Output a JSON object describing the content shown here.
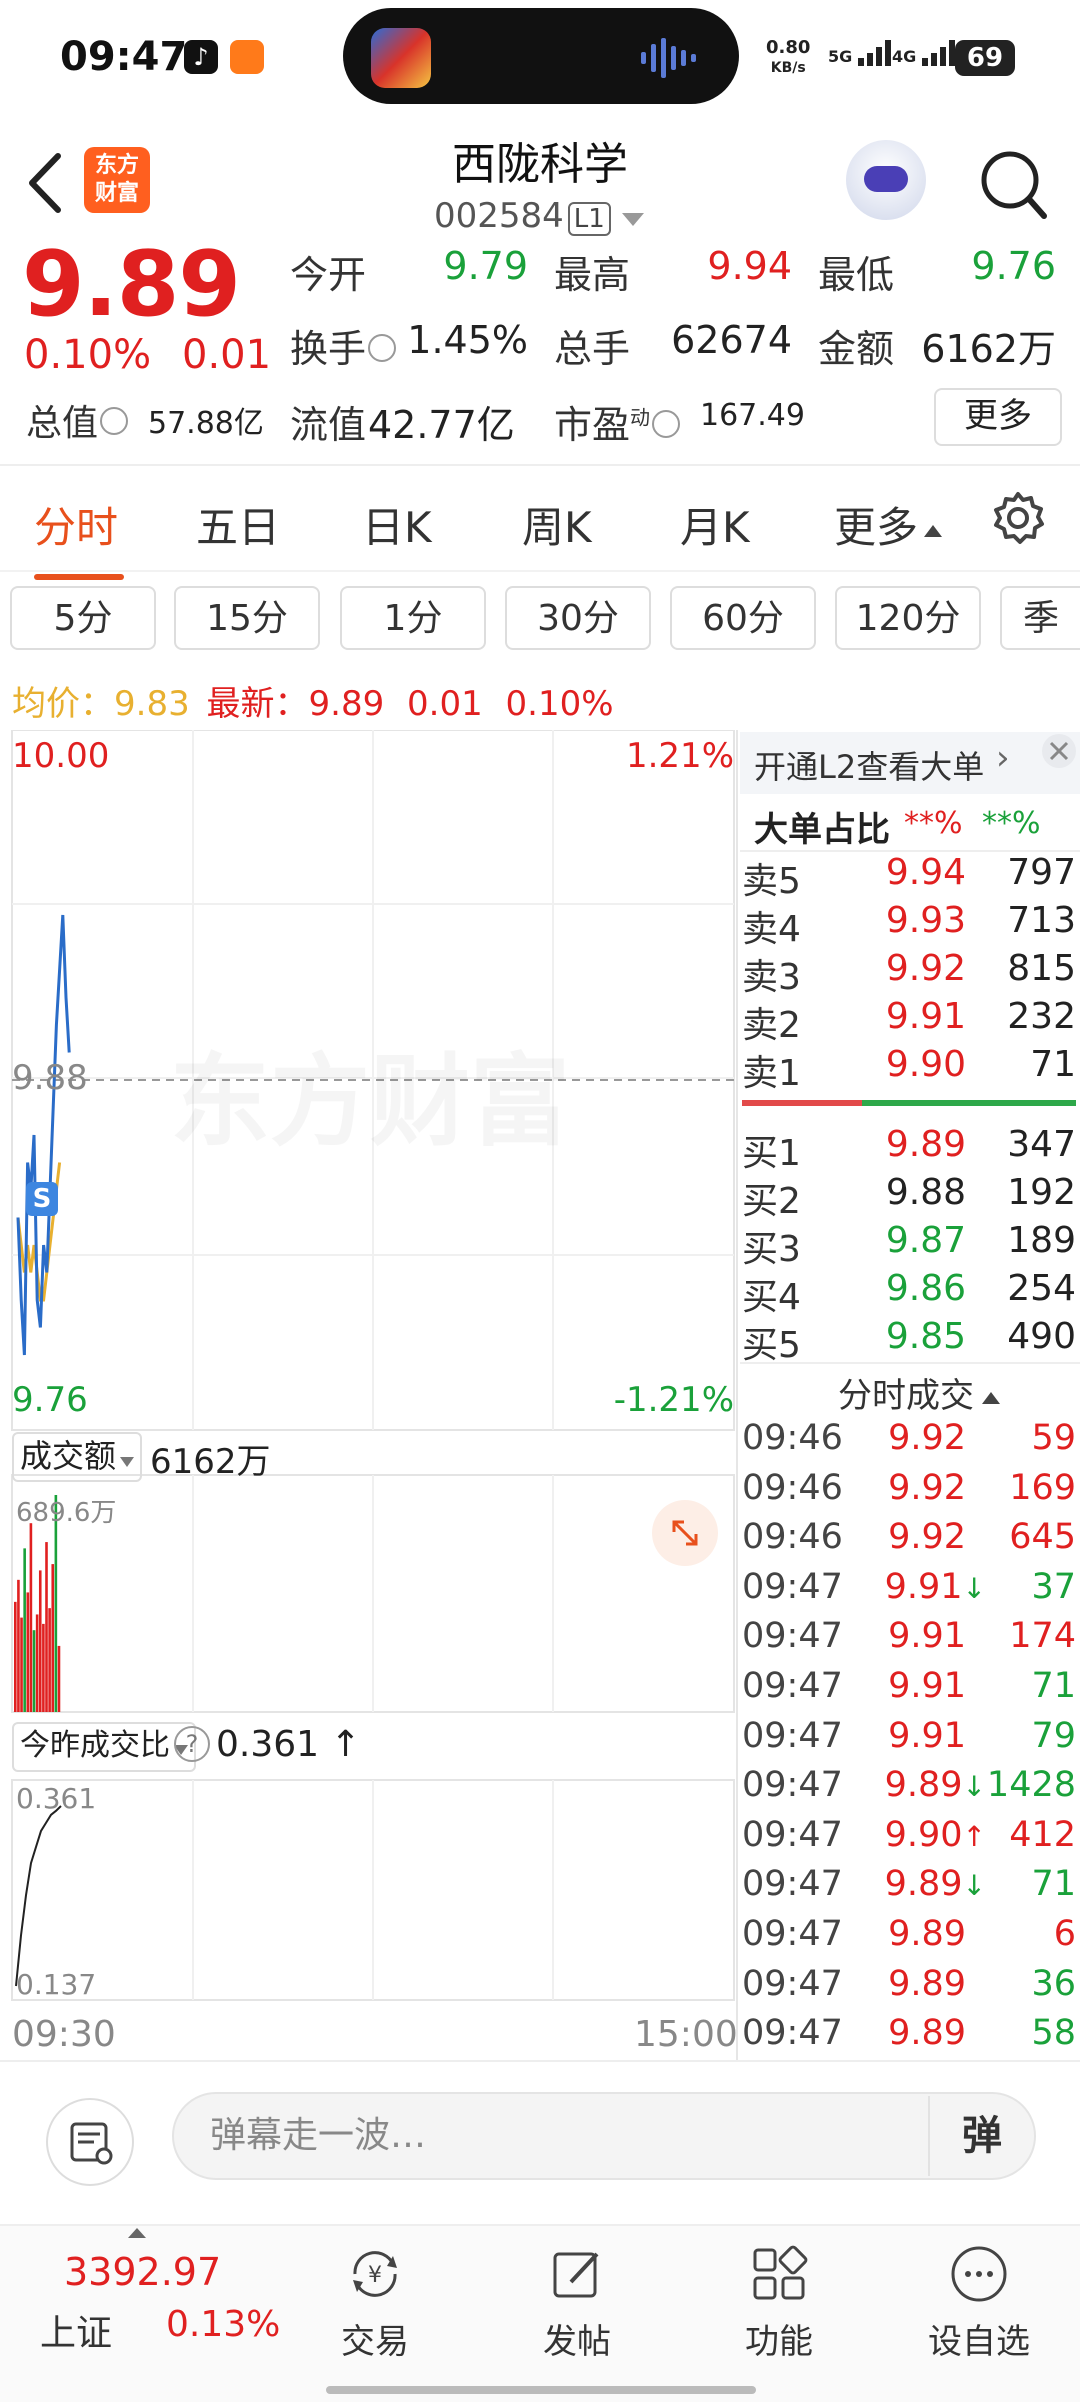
{
  "status_bar": {
    "time": "09:47",
    "net_speed_value": "0.80",
    "net_speed_unit": "KB/s",
    "signal_a": "5G",
    "signal_b": "4G",
    "battery": "69"
  },
  "header": {
    "app_logo_text": "东方\n财富",
    "stock_name": "西陇科学",
    "stock_code": "002584",
    "level_badge": "L1"
  },
  "quote": {
    "price": "9.89",
    "change_pct": "0.10%",
    "change": "0.01",
    "open_label": "今开",
    "open": "9.79",
    "high_label": "最高",
    "high": "9.94",
    "low_label": "最低",
    "low": "9.76",
    "turnover_label": "换手",
    "turnover": "1.45%",
    "volume_label": "总手",
    "volume": "62674",
    "amount_label": "金额",
    "amount": "6162万",
    "mktcap_label": "总值",
    "mktcap": "57.88亿",
    "float_label": "流值",
    "float": "42.77亿",
    "pe_label": "市盈",
    "pe_sup": "动",
    "pe": "167.49",
    "more_btn": "更多"
  },
  "tabs": [
    "分时",
    "五日",
    "日K",
    "周K",
    "月K",
    "更多"
  ],
  "periods": [
    "5分",
    "15分",
    "1分",
    "30分",
    "60分",
    "120分",
    "季"
  ],
  "avg_info": {
    "avg_label": "均价：",
    "avg": "9.83",
    "latest_label": "最新：",
    "latest": "9.89",
    "chg": "0.01",
    "pct": "0.10%"
  },
  "chart": {
    "y_top": "10.00",
    "y_mid": "9.88",
    "y_bot": "9.76",
    "pct_top": "1.21%",
    "pct_bot": "-1.21%",
    "watermark": "东方财富",
    "marker": "S",
    "vol_selector": "成交额",
    "vol_total": "6162万",
    "vol_max": "689.6万",
    "ratio_selector": "今昨成交比",
    "ratio_help": "?",
    "ratio_value": "0.361 ↑",
    "ratio_max": "0.361",
    "ratio_min": "0.137",
    "x_start": "09:30",
    "x_end": "15:00"
  },
  "chart_data": {
    "type": "line",
    "x_range": [
      "09:30",
      "15:00"
    ],
    "ylim": [
      9.76,
      10.0
    ],
    "ref_price": 9.88,
    "series": [
      {
        "values": [
          9.83,
          9.8,
          9.78,
          9.85,
          9.84,
          9.86,
          9.8,
          9.79,
          9.82,
          9.81,
          9.84,
          9.87,
          9.9,
          9.92,
          9.94,
          9.91,
          9.89
        ]
      },
      {
        "values": [
          9.83,
          9.82,
          9.81,
          9.82,
          9.81,
          9.82,
          9.81,
          9.8,
          9.8,
          9.81,
          9.82,
          9.83,
          9.84,
          9.85
        ]
      }
    ],
    "volume_bars": [
      {
        "v": 350,
        "c": "red"
      },
      {
        "v": 420,
        "c": "red"
      },
      {
        "v": 300,
        "c": "red"
      },
      {
        "v": 520,
        "c": "green"
      },
      {
        "v": 380,
        "c": "red"
      },
      {
        "v": 600,
        "c": "red"
      },
      {
        "v": 260,
        "c": "green"
      },
      {
        "v": 310,
        "c": "red"
      },
      {
        "v": 450,
        "c": "red"
      },
      {
        "v": 280,
        "c": "red"
      },
      {
        "v": 540,
        "c": "red"
      },
      {
        "v": 330,
        "c": "red"
      },
      {
        "v": 470,
        "c": "red"
      },
      {
        "v": 689.6,
        "c": "green"
      },
      {
        "v": 210,
        "c": "red"
      }
    ],
    "volume_max": 689.6,
    "ratio_values": [
      0.137,
      0.2,
      0.25,
      0.29,
      0.31,
      0.33,
      0.34,
      0.35,
      0.355,
      0.361
    ],
    "ratio_ylim": [
      0.137,
      0.361
    ]
  },
  "order_book": {
    "l2_banner": "开通L2查看大单",
    "big_order_label": "大单占比",
    "big_order_a": "**%",
    "big_order_b": "**%",
    "asks": [
      {
        "label": "卖5",
        "price": "9.94",
        "vol": "797",
        "color": "red"
      },
      {
        "label": "卖4",
        "price": "9.93",
        "vol": "713",
        "color": "red"
      },
      {
        "label": "卖3",
        "price": "9.92",
        "vol": "815",
        "color": "red"
      },
      {
        "label": "卖2",
        "price": "9.91",
        "vol": "232",
        "color": "red"
      },
      {
        "label": "卖1",
        "price": "9.90",
        "vol": "71",
        "color": "red"
      }
    ],
    "bids": [
      {
        "label": "买1",
        "price": "9.89",
        "vol": "347",
        "color": "red"
      },
      {
        "label": "买2",
        "price": "9.88",
        "vol": "192",
        "color": "black"
      },
      {
        "label": "买3",
        "price": "9.87",
        "vol": "189",
        "color": "green"
      },
      {
        "label": "买4",
        "price": "9.86",
        "vol": "254",
        "color": "green"
      },
      {
        "label": "买5",
        "price": "9.85",
        "vol": "490",
        "color": "green"
      }
    ]
  },
  "trades": {
    "title": "分时成交",
    "rows": [
      {
        "time": "09:46",
        "price": "9.92",
        "arrow": "",
        "vol": "59",
        "vcolor": "red"
      },
      {
        "time": "09:46",
        "price": "9.92",
        "arrow": "",
        "vol": "169",
        "vcolor": "red"
      },
      {
        "time": "09:46",
        "price": "9.92",
        "arrow": "",
        "vol": "645",
        "vcolor": "red"
      },
      {
        "time": "09:47",
        "price": "9.91",
        "arrow": "↓",
        "vol": "37",
        "vcolor": "green"
      },
      {
        "time": "09:47",
        "price": "9.91",
        "arrow": "",
        "vol": "174",
        "vcolor": "red"
      },
      {
        "time": "09:47",
        "price": "9.91",
        "arrow": "",
        "vol": "71",
        "vcolor": "green"
      },
      {
        "time": "09:47",
        "price": "9.91",
        "arrow": "",
        "vol": "79",
        "vcolor": "green"
      },
      {
        "time": "09:47",
        "price": "9.89",
        "arrow": "↓",
        "vol": "1428",
        "vcolor": "green"
      },
      {
        "time": "09:47",
        "price": "9.90",
        "arrow": "↑",
        "vol": "412",
        "vcolor": "red"
      },
      {
        "time": "09:47",
        "price": "9.89",
        "arrow": "↓",
        "vol": "71",
        "vcolor": "green"
      },
      {
        "time": "09:47",
        "price": "9.89",
        "arrow": "",
        "vol": "6",
        "vcolor": "red"
      },
      {
        "time": "09:47",
        "price": "9.89",
        "arrow": "",
        "vol": "36",
        "vcolor": "green"
      },
      {
        "time": "09:47",
        "price": "9.89",
        "arrow": "",
        "vol": "58",
        "vcolor": "green"
      }
    ]
  },
  "comment": {
    "placeholder": "弹幕走一波…",
    "danmu_btn": "弹"
  },
  "bottom_nav": {
    "index_value": "3392.97",
    "index_name": "上证",
    "index_pct": "0.13%",
    "items": [
      "交易",
      "发帖",
      "功能",
      "设自选"
    ]
  },
  "colors": {
    "up": "#e02020",
    "down": "#1aa13a",
    "accent": "#e8501c",
    "avg": "#e8b030",
    "line": "#2a6cc8"
  }
}
